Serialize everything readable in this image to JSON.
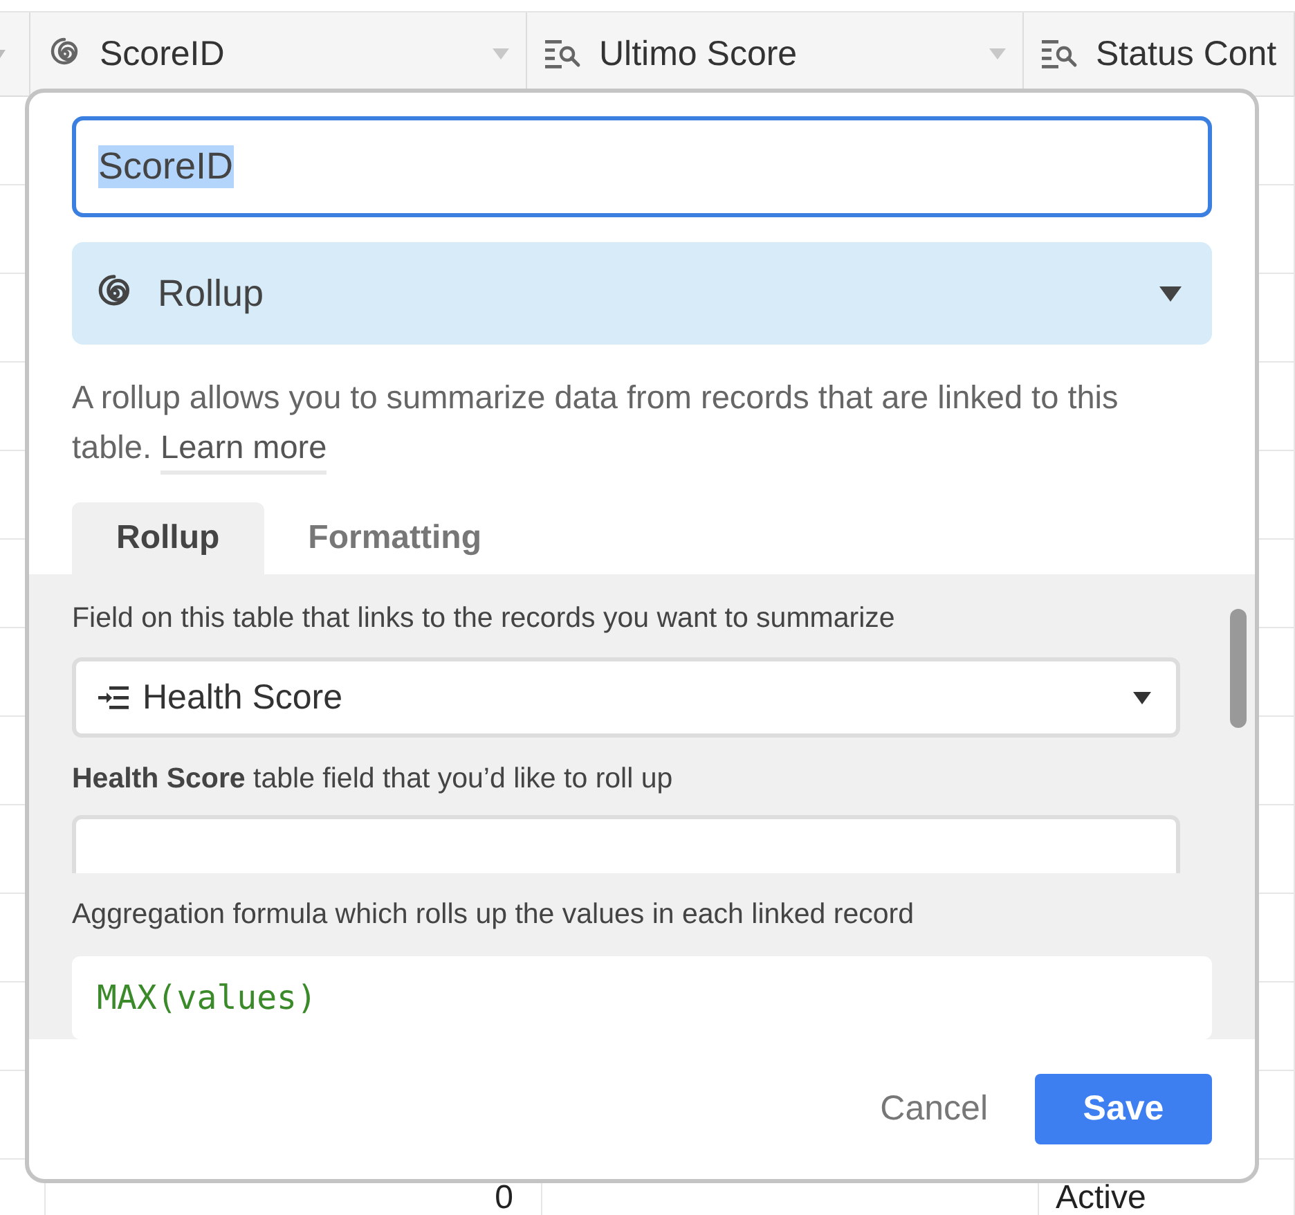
{
  "grid": {
    "columns": [
      {
        "label": "ScoreID",
        "kind": "rollup"
      },
      {
        "label": "Ultimo Score",
        "kind": "lookup"
      },
      {
        "label": "Status Cont",
        "kind": "lookup"
      }
    ],
    "visible_row": {
      "score_id": "0",
      "status": "Active"
    }
  },
  "dialog": {
    "name_field": {
      "value": "ScoreID",
      "text_selected": true
    },
    "type_select": {
      "label": "Rollup",
      "kind": "rollup"
    },
    "description": "A rollup allows you to summarize data from records that are linked to this table.",
    "learn_more": "Learn more",
    "tabs": [
      {
        "label": "Rollup",
        "selected": true
      },
      {
        "label": "Formatting",
        "selected": false
      }
    ],
    "linked_field": {
      "label": "Field on this table that links to the records you want to summarize",
      "value": "Health Score"
    },
    "rollup_field": {
      "label": "**Health Score** table field that you’d like to roll up"
    },
    "aggregation": {
      "label": "Aggregation formula which rolls up the values in each linked record",
      "formula": "MAX(values)"
    },
    "buttons": {
      "cancel": "Cancel",
      "save": "Save"
    }
  }
}
